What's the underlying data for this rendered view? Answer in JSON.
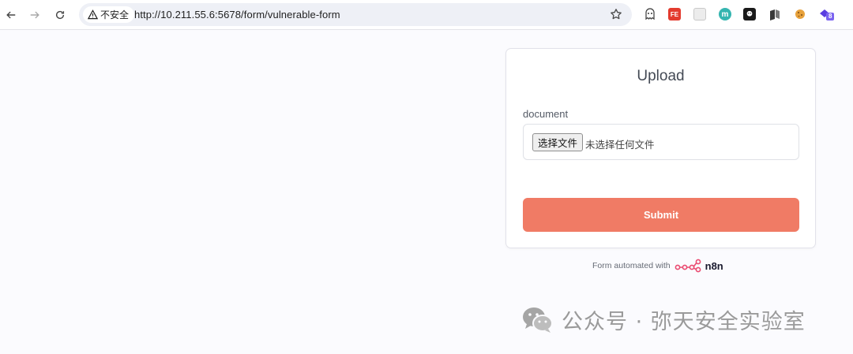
{
  "browser": {
    "security_label": "不安全",
    "url": "http://10.211.55.6:5678/form/vulnerable-form",
    "extensions": [
      {
        "icon": "ghost-extension-icon",
        "color": "#3a3a3a"
      },
      {
        "icon": "fe-extension-icon",
        "color": "#e33b2e",
        "text": "FE"
      },
      {
        "icon": "gray-box-extension-icon",
        "color": "#c9c9c9"
      },
      {
        "icon": "m-extension-icon",
        "color": "#35b5b0",
        "text": "m"
      },
      {
        "icon": "face-extension-icon",
        "color": "#1a1a1a"
      },
      {
        "icon": "book-extension-icon",
        "color": "#4a4a4a"
      },
      {
        "icon": "cookie-extension-icon",
        "color": "#e8a23c"
      },
      {
        "icon": "shield-extension-icon",
        "color": "#5a3ee0",
        "badge": "8"
      }
    ]
  },
  "form": {
    "title": "Upload",
    "field_label": "document",
    "file_button": "选择文件",
    "file_status": "未选择任何文件",
    "submit_label": "Submit"
  },
  "footer": {
    "text": "Form automated with",
    "brand": "n8n"
  },
  "watermark": {
    "text": "公众号 · 弥天安全实验室"
  },
  "colors": {
    "submit": "#f07b65",
    "n8n_brand": "#ea4b71"
  }
}
